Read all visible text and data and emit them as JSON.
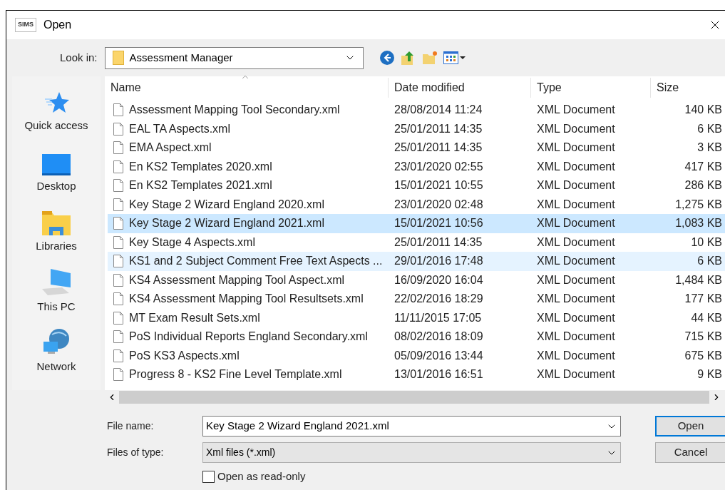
{
  "window": {
    "title": "Open",
    "app_icon_text": "SIMS"
  },
  "look_in": {
    "label": "Look in:",
    "value": "Assessment Manager"
  },
  "places": [
    {
      "label": "Quick access",
      "kind": "star"
    },
    {
      "label": "Desktop",
      "kind": "desktop"
    },
    {
      "label": "Libraries",
      "kind": "libraries"
    },
    {
      "label": "This PC",
      "kind": "pc"
    },
    {
      "label": "Network",
      "kind": "network"
    }
  ],
  "table": {
    "columns": [
      "Name",
      "Date modified",
      "Type",
      "Size"
    ],
    "rows": [
      {
        "name": "Assessment Mapping Tool Secondary.xml",
        "date": "28/08/2014 11:24",
        "type": "XML Document",
        "size": "140 KB",
        "selected": false,
        "hovered": false
      },
      {
        "name": "EAL TA Aspects.xml",
        "date": "25/01/2011 14:35",
        "type": "XML Document",
        "size": "6 KB",
        "selected": false,
        "hovered": false
      },
      {
        "name": "EMA Aspect.xml",
        "date": "25/01/2011 14:35",
        "type": "XML Document",
        "size": "3 KB",
        "selected": false,
        "hovered": false
      },
      {
        "name": "En KS2 Templates 2020.xml",
        "date": "23/01/2020 02:55",
        "type": "XML Document",
        "size": "417 KB",
        "selected": false,
        "hovered": false
      },
      {
        "name": "En KS2 Templates 2021.xml",
        "date": "15/01/2021 10:55",
        "type": "XML Document",
        "size": "286 KB",
        "selected": false,
        "hovered": false
      },
      {
        "name": "Key Stage 2 Wizard England 2020.xml",
        "date": "23/01/2020 02:48",
        "type": "XML Document",
        "size": "1,275 KB",
        "selected": false,
        "hovered": false
      },
      {
        "name": "Key Stage 2 Wizard England 2021.xml",
        "date": "15/01/2021 10:56",
        "type": "XML Document",
        "size": "1,083 KB",
        "selected": true,
        "hovered": false
      },
      {
        "name": "Key Stage 4 Aspects.xml",
        "date": "25/01/2011 14:35",
        "type": "XML Document",
        "size": "10 KB",
        "selected": false,
        "hovered": false
      },
      {
        "name": "KS1 and 2 Subject Comment Free Text Aspects ...",
        "date": "29/01/2016 17:48",
        "type": "XML Document",
        "size": "6 KB",
        "selected": false,
        "hovered": true
      },
      {
        "name": "KS4 Assessment Mapping Tool Aspect.xml",
        "date": "16/09/2020 16:04",
        "type": "XML Document",
        "size": "1,484 KB",
        "selected": false,
        "hovered": false
      },
      {
        "name": "KS4 Assessment Mapping Tool Resultsets.xml",
        "date": "22/02/2016 18:29",
        "type": "XML Document",
        "size": "177 KB",
        "selected": false,
        "hovered": false
      },
      {
        "name": "MT Exam Result Sets.xml",
        "date": "11/11/2015 17:05",
        "type": "XML Document",
        "size": "44 KB",
        "selected": false,
        "hovered": false
      },
      {
        "name": "PoS Individual Reports England Secondary.xml",
        "date": "08/02/2016 18:09",
        "type": "XML Document",
        "size": "715 KB",
        "selected": false,
        "hovered": false
      },
      {
        "name": "PoS KS3 Aspects.xml",
        "date": "05/09/2016 13:44",
        "type": "XML Document",
        "size": "675 KB",
        "selected": false,
        "hovered": false
      },
      {
        "name": "Progress 8 - KS2 Fine Level Template.xml",
        "date": "13/01/2016 16:51",
        "type": "XML Document",
        "size": "9 KB",
        "selected": false,
        "hovered": false
      }
    ]
  },
  "file_name": {
    "label": "File name:",
    "value": "Key Stage 2 Wizard England 2021.xml"
  },
  "file_type": {
    "label": "Files of type:",
    "value": "Xml files (*.xml)"
  },
  "read_only": {
    "label": "Open as read-only",
    "checked": false
  },
  "buttons": [
    {
      "label": "Open",
      "default": true
    },
    {
      "label": "Cancel",
      "default": false
    }
  ]
}
